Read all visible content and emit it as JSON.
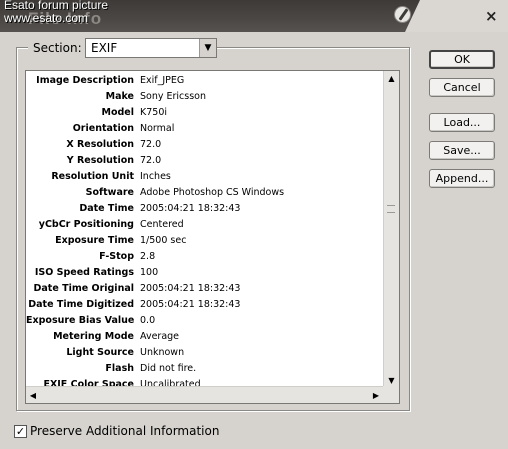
{
  "window": {
    "watermark_line1": "Esato forum picture",
    "watermark_line2": "www.esato.com",
    "title": "File Info",
    "logo_icon": "photoshop-feather-icon",
    "close_label": "×"
  },
  "section": {
    "label": "Section:",
    "value": "EXIF"
  },
  "exif": {
    "rows": [
      {
        "key": "Image Description",
        "value": "Exif_JPEG"
      },
      {
        "key": "Make",
        "value": "Sony Ericsson"
      },
      {
        "key": "Model",
        "value": "K750i"
      },
      {
        "key": "Orientation",
        "value": "Normal"
      },
      {
        "key": "X Resolution",
        "value": "72.0"
      },
      {
        "key": "Y Resolution",
        "value": "72.0"
      },
      {
        "key": "Resolution Unit",
        "value": "Inches"
      },
      {
        "key": "Software",
        "value": "Adobe Photoshop CS Windows"
      },
      {
        "key": "Date Time",
        "value": "2005:04:21 18:32:43"
      },
      {
        "key": "yCbCr Positioning",
        "value": "Centered"
      },
      {
        "key": "Exposure Time",
        "value": "1/500 sec"
      },
      {
        "key": "F-Stop",
        "value": "2.8"
      },
      {
        "key": "ISO Speed Ratings",
        "value": "100"
      },
      {
        "key": "Date Time Original",
        "value": "2005:04:21 18:32:43"
      },
      {
        "key": "Date Time Digitized",
        "value": "2005:04:21 18:32:43"
      },
      {
        "key": "Exposure Bias Value",
        "value": "0.0"
      },
      {
        "key": "Metering Mode",
        "value": "Average"
      },
      {
        "key": "Light Source",
        "value": "Unknown"
      },
      {
        "key": "Flash",
        "value": "Did not fire."
      },
      {
        "key": "EXIF Color Space",
        "value": "Uncalibrated"
      }
    ]
  },
  "buttons": {
    "ok": "OK",
    "cancel": "Cancel",
    "load": "Load...",
    "save": "Save...",
    "append": "Append..."
  },
  "preserve": {
    "label": "Preserve Additional Information",
    "checked": true,
    "check_glyph": "✓"
  }
}
